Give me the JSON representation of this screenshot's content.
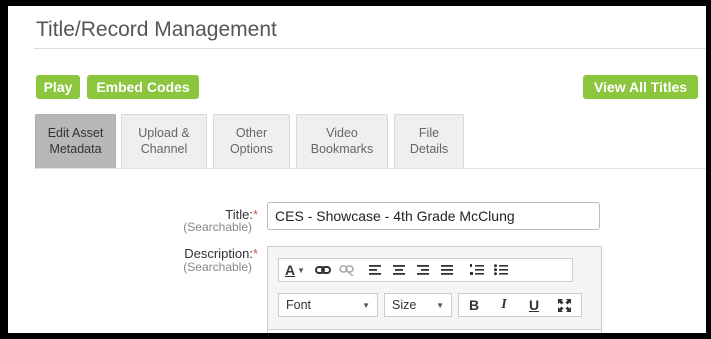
{
  "header": {
    "title": "Title/Record Management"
  },
  "actions": {
    "play_label": "Play",
    "embed_label": "Embed Codes",
    "view_all_label": "View All Titles"
  },
  "tabs": [
    {
      "line1": "Edit Asset",
      "line2": "Metadata",
      "active": true
    },
    {
      "line1": "Upload &",
      "line2": "Channel",
      "active": false
    },
    {
      "line1": "Other",
      "line2": "Options",
      "active": false
    },
    {
      "line1": "Video",
      "line2": "Bookmarks",
      "active": false
    },
    {
      "line1": "File",
      "line2": "Details",
      "active": false
    }
  ],
  "form": {
    "title_label": "Title:",
    "required_mark": "*",
    "searchable_hint": "(Searchable)",
    "title_value": "CES - Showcase - 4th Grade McClung",
    "description_label": "Description:"
  },
  "editor": {
    "font_label": "Font",
    "size_label": "Size",
    "bold_glyph": "B",
    "italic_glyph": "I",
    "underline_glyph": "U",
    "text_color_glyph": "A"
  },
  "colors": {
    "accent": "#8cc63f",
    "required": "#d9534f",
    "active_tab": "#b7b7b7"
  }
}
